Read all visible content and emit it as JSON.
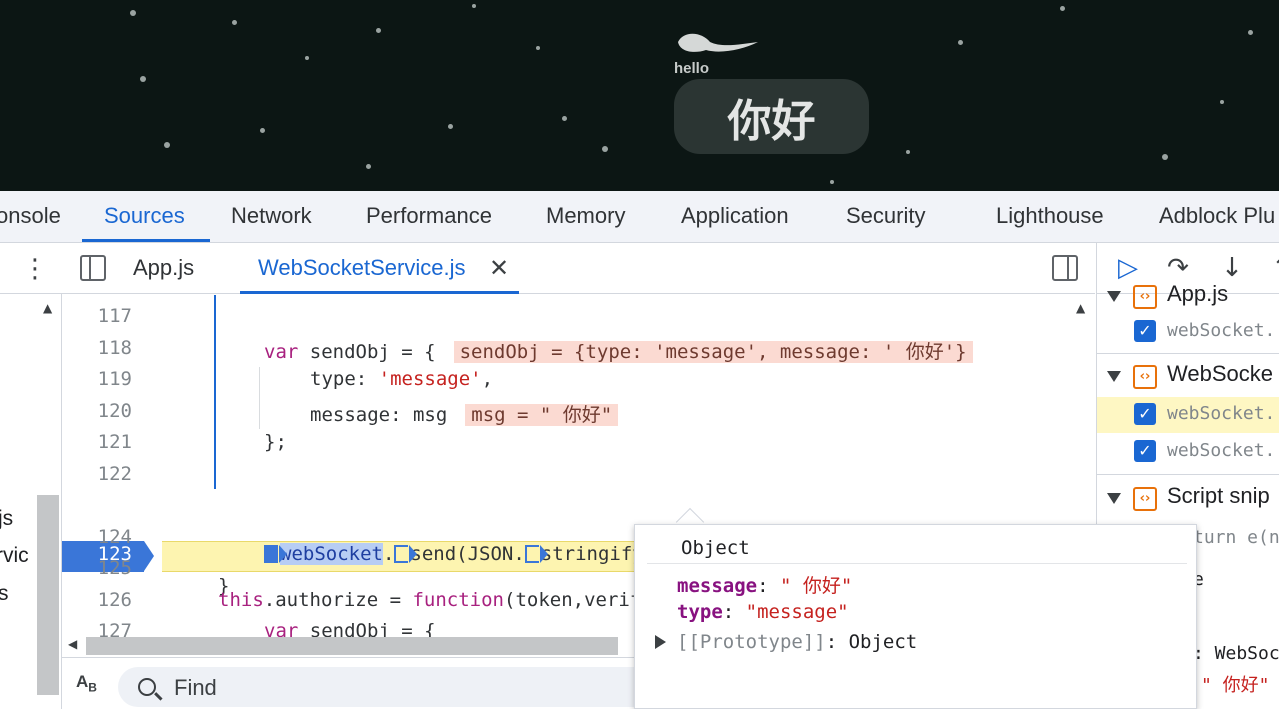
{
  "page": {
    "hello_text": "hello",
    "nihao_text": "你好"
  },
  "devtools_tabs": [
    "onsole",
    "Sources",
    "Network",
    "Performance",
    "Memory",
    "Application",
    "Security",
    "Lighthouse",
    "Adblock Plu"
  ],
  "active_tab": "Sources",
  "editor": {
    "file_tabs": [
      "App.js",
      "WebSocketService.js"
    ],
    "active_file": "WebSocketService.js",
    "line_numbers": [
      "117",
      "118",
      "119",
      "120",
      "121",
      "122",
      "123",
      "124",
      "125",
      "126",
      "127"
    ],
    "current_line": "123",
    "code": {
      "l118_a": "var",
      "l118_b": " sendObj = {",
      "l118_inline": "sendObj = {type: 'message', message: ' 你好'}",
      "l119_a": "type: ",
      "l119_b": "'message'",
      "l119_c": ",",
      "l120_a": "message: msg",
      "l120_inline": "msg = \" 你好\"",
      "l121": "};",
      "l123_a": "webSocket",
      "l123_b": ".",
      "l123_c": "send(JSON.",
      "l123_d": "stringify(",
      "l123_e": "sendObj",
      "l123_f": "));",
      "l124": "}",
      "l126_a": "this",
      "l126_b": ".authorize = ",
      "l126_c": "function",
      "l126_d": "(token,verif",
      "l127_a": "var",
      "l127_b": " sendObj = {"
    },
    "find_placeholder": "Find",
    "find_options_label": "A B"
  },
  "left_tree": [
    "js",
    "rvic",
    "s"
  ],
  "debugger": {
    "groups": [
      {
        "label": "App.js",
        "items": [
          "webSocket."
        ]
      },
      {
        "label": "WebSocke",
        "items": [
          "webSocket.",
          "webSocket."
        ]
      },
      {
        "label": "Script snip",
        "items": []
      }
    ],
    "partial_texts": [
      "turn e(n",
      "e",
      ": WebSoc",
      "\" 你好\""
    ]
  },
  "popover": {
    "title": "Object",
    "props": [
      {
        "key": "message",
        "value": "\" 你好\""
      },
      {
        "key": "type",
        "value": "\"message\""
      }
    ],
    "proto_key": "[[Prototype]]",
    "proto_value": ": Object"
  },
  "colors": {
    "accent": "#1a67d2",
    "breakpoint": "#3a76d8",
    "exec_line": "#fdf4b0",
    "inline_value_bg": "#fbdad2"
  }
}
